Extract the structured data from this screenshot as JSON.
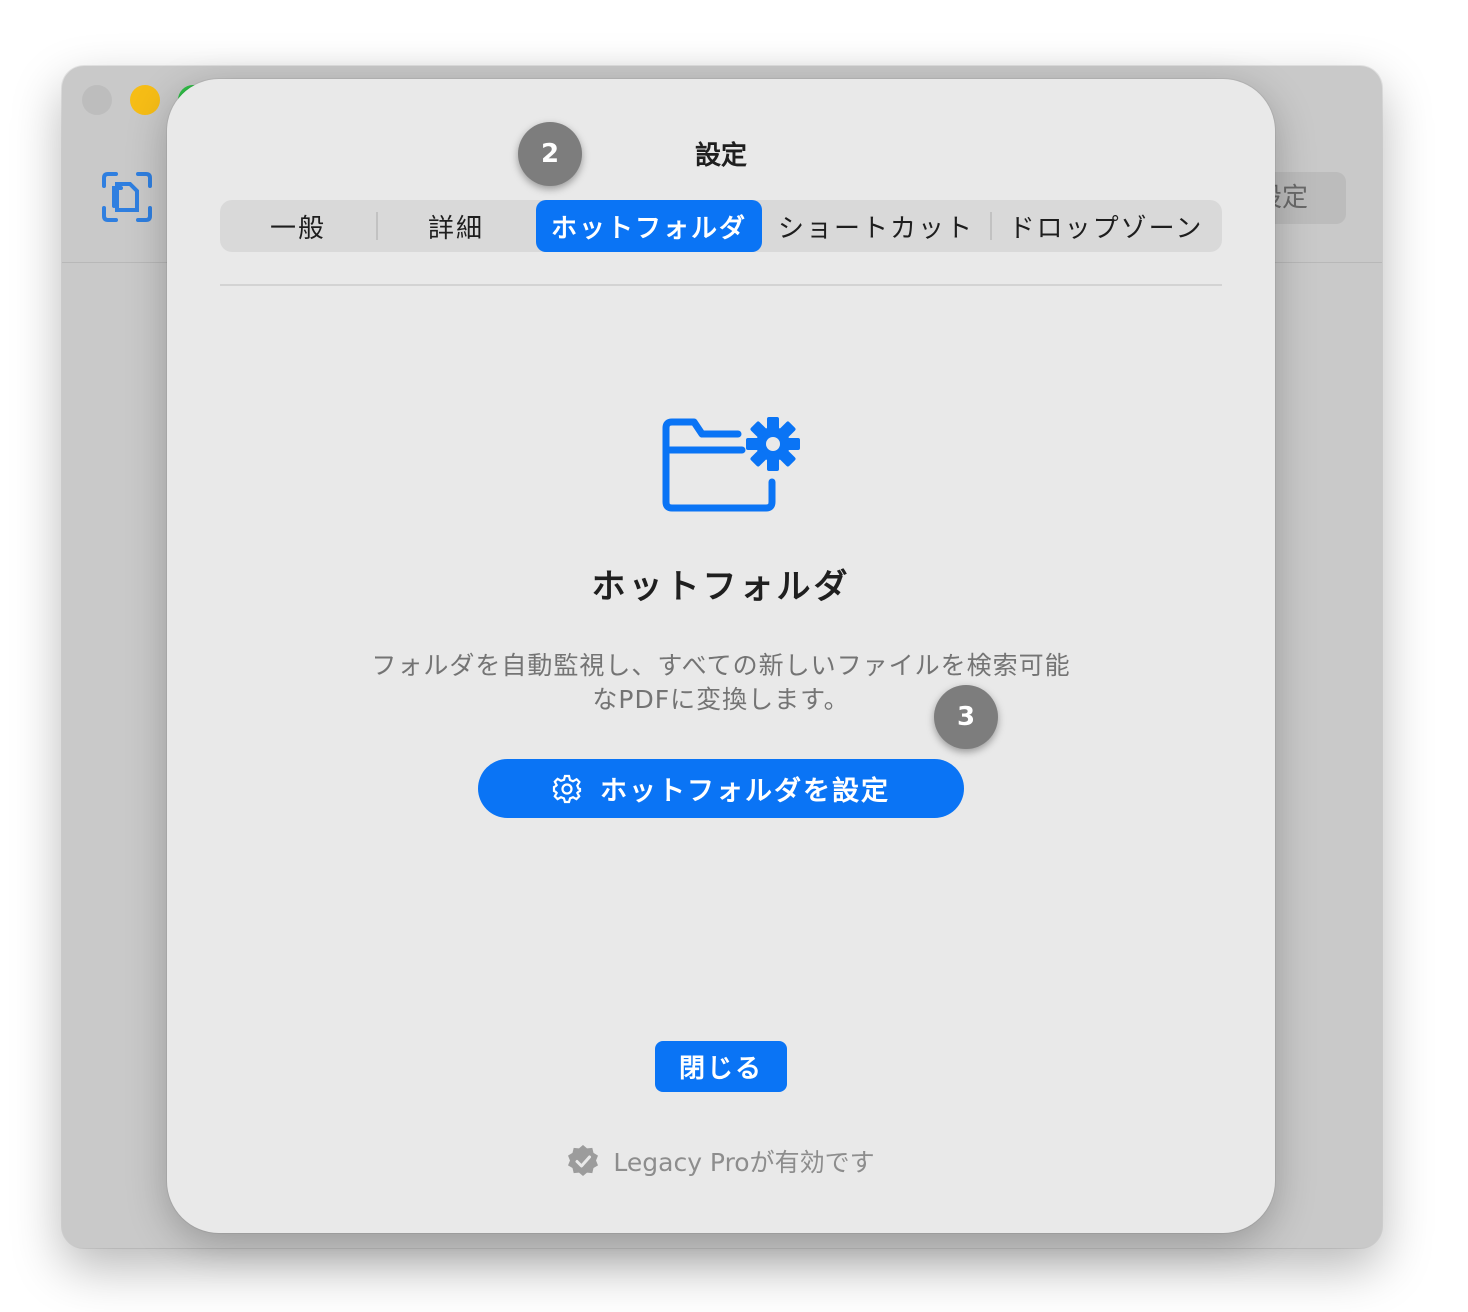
{
  "background_window": {
    "settings_button_label": "設定"
  },
  "dialog": {
    "title": "設定",
    "tabs": [
      {
        "label": "一般",
        "active": false
      },
      {
        "label": "詳細",
        "active": false
      },
      {
        "label": "ホットフォルダ",
        "active": true
      },
      {
        "label": "ショートカット",
        "active": false
      },
      {
        "label": "ドロップゾーン",
        "active": false
      }
    ],
    "content": {
      "icon": "folder-gear-icon",
      "heading": "ホットフォルダ",
      "description_line1": "フォルダを自動監視し、すべての新しいファイルを検索可能",
      "description_line2": "なPDFに変換します。",
      "primary_button_label": "ホットフォルダを設定",
      "primary_button_icon": "gear-icon"
    },
    "close_button_label": "閉じる",
    "status": {
      "icon": "verified-badge-icon",
      "text": "Legacy Proが有効です"
    }
  },
  "step_markers": {
    "step2": "2",
    "step3": "3"
  },
  "colors": {
    "accent": "#0a74f5",
    "sheet_background": "#e9e9e9",
    "marker": "#7d7d7d"
  }
}
